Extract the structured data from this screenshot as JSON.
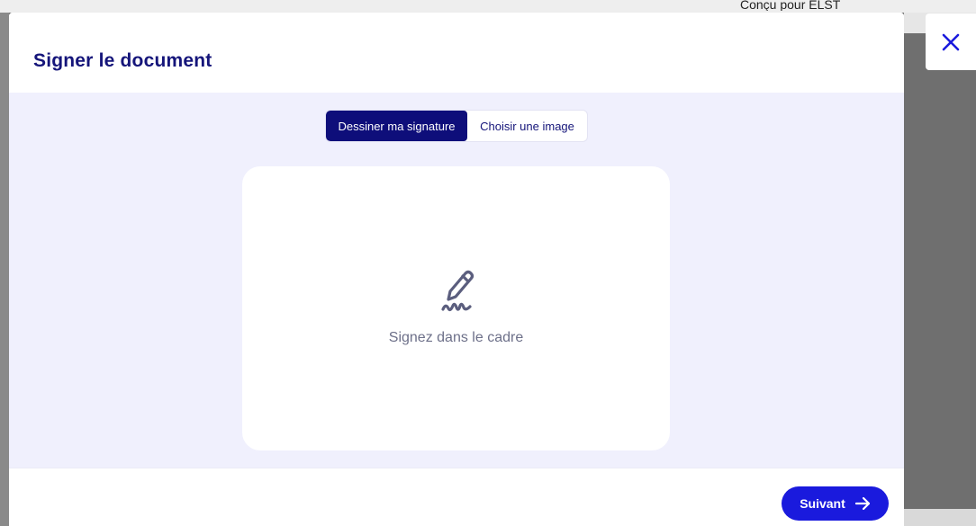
{
  "background": {
    "header_text": "Conçu pour ELST"
  },
  "modal": {
    "title": "Signer le document",
    "tabs": [
      {
        "label": "Dessiner ma signature",
        "active": true
      },
      {
        "label": "Choisir une image",
        "active": false
      }
    ],
    "signature_pad": {
      "icon": "pen-signature-icon",
      "hint": "Signez dans le cadre"
    },
    "footer": {
      "next_label": "Suivant",
      "next_icon": "arrow-right-icon"
    }
  },
  "close": {
    "icon": "close-icon"
  },
  "colors": {
    "brand_dark": "#0e0e7a",
    "brand_primary": "#1a1add",
    "body_tint": "#f0f0fd",
    "overlay": "#6f6f6f"
  }
}
